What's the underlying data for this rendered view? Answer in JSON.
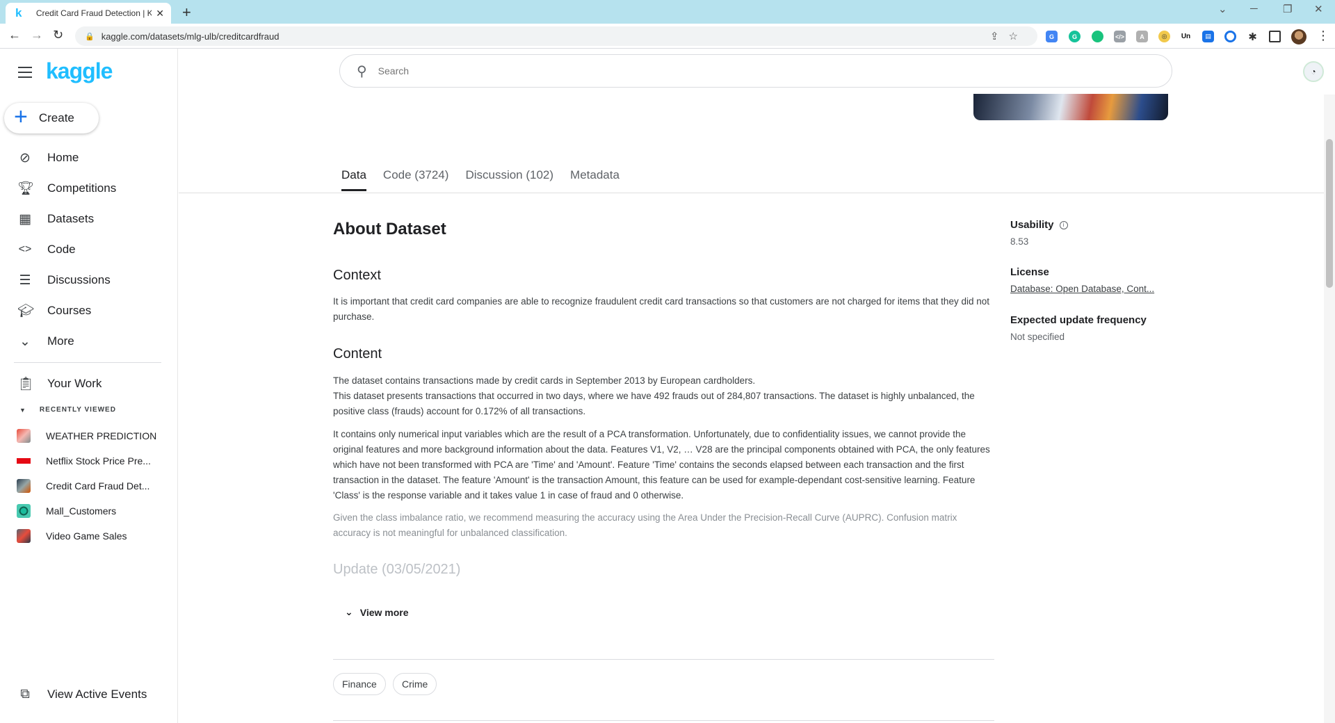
{
  "browser": {
    "tab_title": "Credit Card Fraud Detection | Kaggle",
    "tab_favicon": "k",
    "url": "kaggle.com/datasets/mlg-ulb/creditcardfraud",
    "ext_un": "Un"
  },
  "sidebar": {
    "logo": "kaggle",
    "create_label": "Create",
    "items": [
      {
        "label": "Home",
        "icon": "compass-icon"
      },
      {
        "label": "Competitions",
        "icon": "trophy-icon"
      },
      {
        "label": "Datasets",
        "icon": "table-icon"
      },
      {
        "label": "Code",
        "icon": "code-icon"
      },
      {
        "label": "Discussions",
        "icon": "comments-icon"
      },
      {
        "label": "Courses",
        "icon": "school-icon"
      },
      {
        "label": "More",
        "icon": "chevron-down-icon"
      }
    ],
    "your_work": "Your Work",
    "recently_viewed_label": "RECENTLY VIEWED",
    "recent": [
      {
        "name": "WEATHER PREDICTION"
      },
      {
        "name": "Netflix Stock Price Pre..."
      },
      {
        "name": "Credit Card Fraud Det..."
      },
      {
        "name": "Mall_Customers"
      },
      {
        "name": "Video Game Sales"
      }
    ],
    "view_active_events": "View Active Events"
  },
  "search": {
    "placeholder": "Search"
  },
  "tabs": [
    {
      "label": "Data",
      "active": true
    },
    {
      "label": "Code (3724)"
    },
    {
      "label": "Discussion (102)"
    },
    {
      "label": "Metadata"
    }
  ],
  "about": {
    "title": "About Dataset",
    "context_title": "Context",
    "context_text": "It is important that credit card companies are able to recognize fraudulent credit card transactions so that customers are not charged for items that they did not purchase.",
    "content_title": "Content",
    "content_p1a": "The dataset contains transactions made by credit cards in September 2013 by European cardholders.",
    "content_p1b": "This dataset presents transactions that occurred in two days, where we have 492 frauds out of 284,807 transactions. The dataset is highly unbalanced, the positive class (frauds) account for 0.172% of all transactions.",
    "content_p2": "It contains only numerical input variables which are the result of a PCA transformation. Unfortunately, due to confidentiality issues, we cannot provide the original features and more background information about the data. Features V1, V2, … V28 are the principal components obtained with PCA, the only features which have not been transformed with PCA are 'Time' and 'Amount'. Feature 'Time' contains the seconds elapsed between each transaction and the first transaction in the dataset. The feature 'Amount' is the transaction Amount, this feature can be used for example-dependant cost-sensitive learning. Feature 'Class' is the response variable and it takes value 1 in case of fraud and 0 otherwise.",
    "content_p3": "Given the class imbalance ratio, we recommend measuring the accuracy using the Area Under the Precision-Recall Curve (AUPRC). Confusion matrix accuracy is not meaningful for unbalanced classification.",
    "update_title": "Update (03/05/2021)",
    "view_more": "View more"
  },
  "tags": [
    "Finance",
    "Crime"
  ],
  "meta": {
    "usability_label": "Usability",
    "usability_value": "8.53",
    "license_label": "License",
    "license_value": "Database: Open Database, Cont...",
    "frequency_label": "Expected update frequency",
    "frequency_value": "Not specified"
  },
  "colors": {
    "kaggle_blue": "#20beff",
    "tab_bar": "#b6e2ee"
  }
}
